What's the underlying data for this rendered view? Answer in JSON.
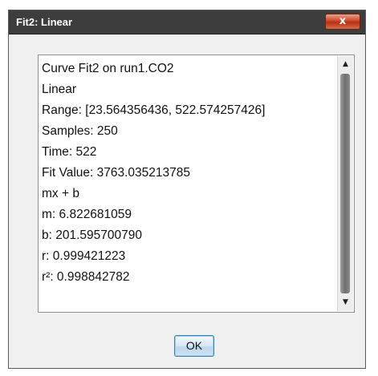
{
  "window": {
    "title": "Fit2: Linear",
    "close_label": "x"
  },
  "content": {
    "lines": [
      "Curve Fit2 on run1.CO2",
      "Linear",
      "Range: [23.564356436, 522.574257426]",
      "Samples: 250",
      "Time: 522",
      "Fit Value: 3763.035213785",
      "mx + b",
      "m: 6.822681059",
      "b: 201.595700790",
      "r: 0.999421223",
      "r²: 0.998842782"
    ]
  },
  "scrollbar": {
    "up_icon": "▲",
    "down_icon": "▼"
  },
  "footer": {
    "ok_label": "OK"
  }
}
